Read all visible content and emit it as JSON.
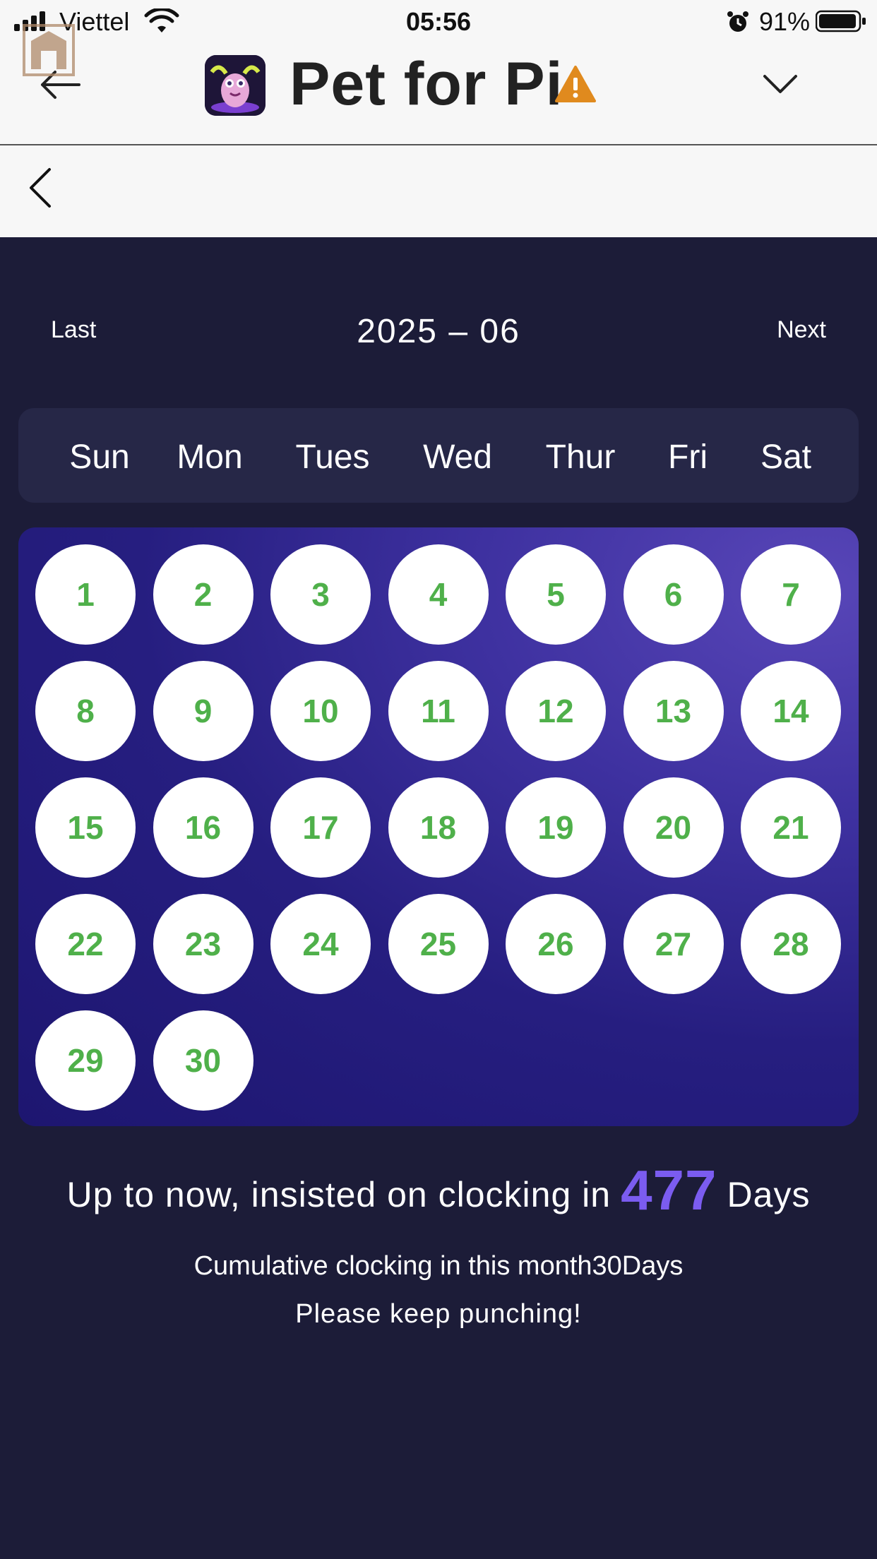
{
  "status_bar": {
    "carrier": "Viettel",
    "time": "05:56",
    "battery": "91%"
  },
  "header": {
    "app_title": "Pet for Pi",
    "icons": [
      "home-badge-icon",
      "back-arrow-icon",
      "app-icon",
      "warning-icon",
      "chevron-down-icon"
    ]
  },
  "nav": {
    "icons": [
      "chevron-left-icon"
    ]
  },
  "calendar": {
    "last_label": "Last",
    "next_label": "Next",
    "month": "2025 – 06",
    "weekdays": [
      "Sun",
      "Mon",
      "Tues",
      "Wed",
      "Thur",
      "Fri",
      "Sat"
    ],
    "days": [
      "1",
      "2",
      "3",
      "4",
      "5",
      "6",
      "7",
      "8",
      "9",
      "10",
      "11",
      "12",
      "13",
      "14",
      "15",
      "16",
      "17",
      "18",
      "19",
      "20",
      "21",
      "22",
      "23",
      "24",
      "25",
      "26",
      "27",
      "28",
      "29",
      "30"
    ]
  },
  "summary": {
    "prefix": "Up to now, insisted on clocking in",
    "total_days": "477",
    "suffix": "Days",
    "month_line": "Cumulative clocking in this month30Days",
    "encourage": "Please keep punching!"
  },
  "colors": {
    "background": "#1c1c38",
    "day_number": "#4fb04a",
    "highlight": "#7b5cf0",
    "warning": "#e08a1e"
  }
}
